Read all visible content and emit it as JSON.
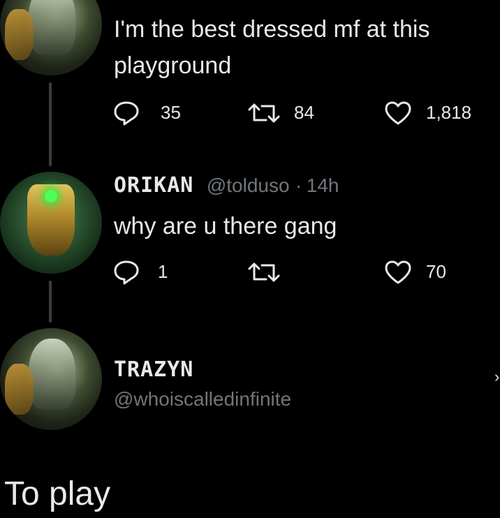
{
  "tweet1": {
    "body_line1": "I'm the best dressed mf at this",
    "body_line2": "playground",
    "replies": "35",
    "reposts": "84",
    "likes": "1,818"
  },
  "tweet2": {
    "name": "ORIKAN",
    "handle": "@tolduso",
    "separator": "·",
    "time": "14h",
    "body": "why are u there gang",
    "replies": "1",
    "likes": "70"
  },
  "tweet3": {
    "name": "TRAZYN",
    "handle": "@whoiscalledinfinite"
  },
  "caption": "To play",
  "icons": [
    "reply-icon",
    "repost-icon",
    "like-icon",
    "chevron-right-icon"
  ],
  "colors": {
    "background": "#000000",
    "text": "#e7e9ea",
    "muted": "#71767b",
    "thread_line": "#3a3d40"
  }
}
